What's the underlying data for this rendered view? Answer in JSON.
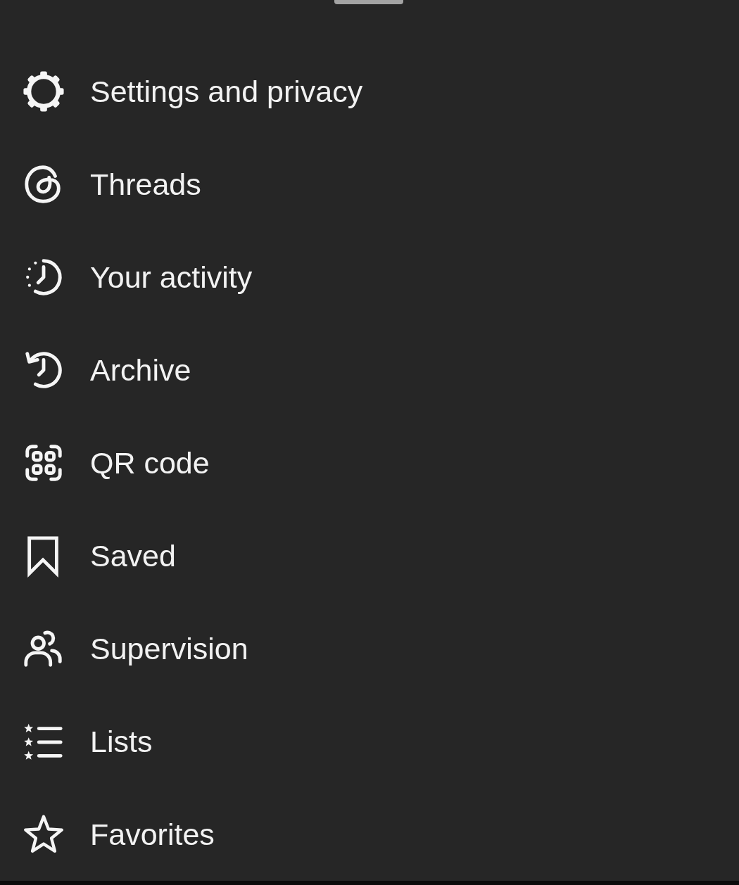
{
  "menu": {
    "items": [
      {
        "label": "Settings and privacy",
        "kind": "gear"
      },
      {
        "label": "Threads",
        "kind": "swirl"
      },
      {
        "label": "Your activity",
        "kind": "activity"
      },
      {
        "label": "Archive",
        "kind": "archive"
      },
      {
        "label": "QR code",
        "kind": "qr"
      },
      {
        "label": "Saved",
        "kind": "bookmark"
      },
      {
        "label": "Supervision",
        "kind": "people"
      },
      {
        "label": "Lists",
        "kind": "starlist"
      },
      {
        "label": "Favorites",
        "kind": "star"
      }
    ]
  }
}
